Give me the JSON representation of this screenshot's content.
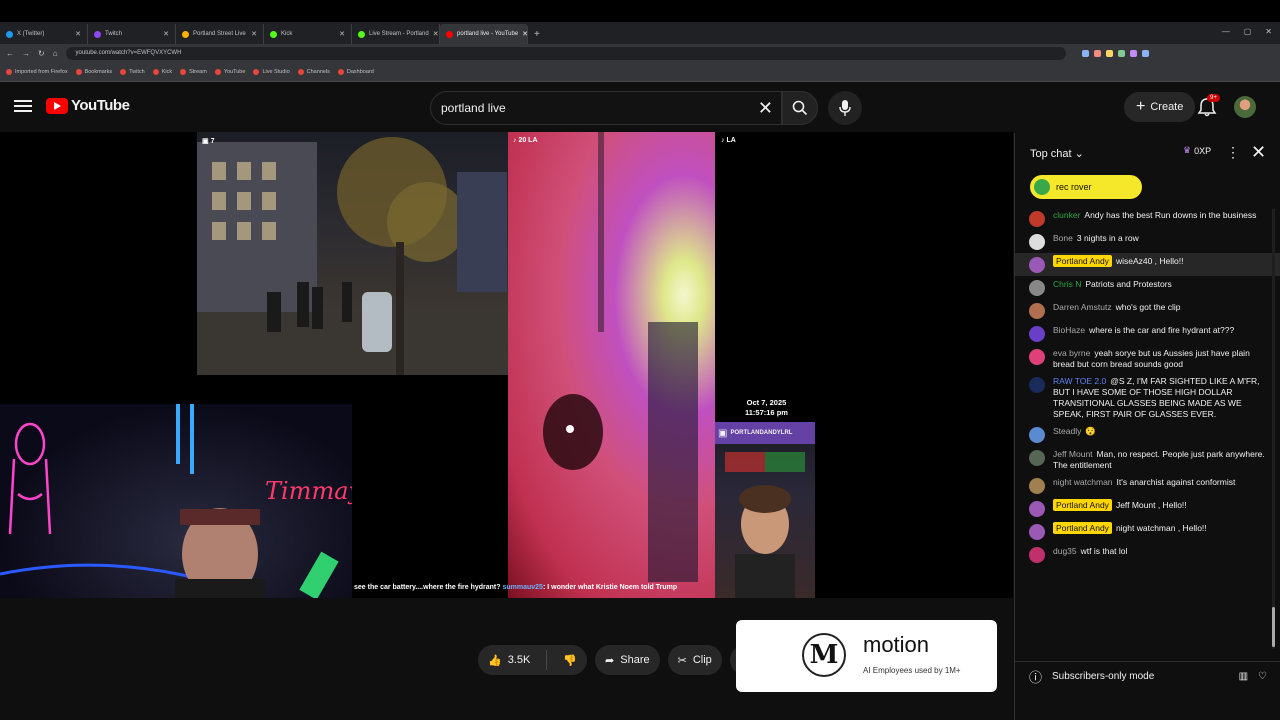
{
  "browser": {
    "tabs": [
      {
        "label": "X (Twitter)",
        "color": "#1d9bf0"
      },
      {
        "label": "Twitch",
        "color": "#9146ff"
      },
      {
        "label": "Portland Street Live",
        "color": "#ffb000"
      },
      {
        "label": "Kick",
        "color": "#53fc18"
      },
      {
        "label": "Live Stream - Portland",
        "color": "#53fc18"
      },
      {
        "label": "portland live - YouTube",
        "color": "#ff0000",
        "active": true
      }
    ],
    "url": "youtube.com/watch?v=EWFQVXYCWH",
    "bookmarks": [
      "Imported from Firefox",
      "Bookmarks",
      "Twitch",
      "Kick",
      "Stream",
      "YouTube",
      "Live Studio",
      "Channels",
      "Dashboard"
    ]
  },
  "masthead": {
    "logo_text": "YouTube",
    "search_value": "portland live",
    "create_label": "Create",
    "notification_badge": "9+"
  },
  "video": {
    "tag_left": "7",
    "tag_mid": "20 LA",
    "tag_right": "LA",
    "caption_pre": "see the car battery....where the fire hydrant?",
    "caption_user": "summauv25",
    "caption_post": ": I wonder what Kristie Noem told Trump",
    "date_line1": "Oct 7, 2025",
    "date_line2": "11:57:16 pm",
    "twitch_name": "PORTLANDANDYLRL",
    "webcam_neon": "Timmay"
  },
  "actions": {
    "likes": "3.5K",
    "share": "Share",
    "clip": "Clip"
  },
  "ad": {
    "title": "motion",
    "subtitle": "AI Employees used by 1M+"
  },
  "chat": {
    "header": "Top chat",
    "xp": "0XP",
    "pinned_user": "rec rover",
    "footer": "Subscribers-only mode",
    "messages": [
      {
        "author": "clunker",
        "text": "Andy has the best Run downs in the business",
        "kind": "member",
        "av": "#c0392b"
      },
      {
        "author": "Bone",
        "text": "3 nights in a row",
        "kind": "",
        "av": "#dddddd"
      },
      {
        "author": "Portland Andy",
        "text": "wiseAz40 , Hello!!",
        "kind": "owner",
        "av": "#9a59b5",
        "hl": true
      },
      {
        "author": "Chris N",
        "text": "Patriots and Protestors",
        "kind": "member",
        "av": "#888888"
      },
      {
        "author": "Darren Amstutz",
        "text": "who's got the clip",
        "kind": "",
        "av": "#b07050"
      },
      {
        "author": "BioHaze",
        "text": "where is the car and fire hydrant at???",
        "kind": "",
        "av": "#6a3fc7"
      },
      {
        "author": "eva byrne",
        "text": "yeah sorye but us Aussies just have plain bread but corn bread sounds good",
        "kind": "",
        "av": "#e0407a"
      },
      {
        "author": "RAW TOE 2.0",
        "text": "@S Z, I'M FAR SIGHTED LIKE A M'FR, BUT I HAVE SOME OF THOSE HIGH DOLLAR TRANSITIONAL GLASSES BEING MADE AS WE SPEAK, FIRST PAIR OF GLASSES EVER.",
        "kind": "mod",
        "av": "#1a2a5a"
      },
      {
        "author": "Steadly",
        "text": "😯",
        "kind": "",
        "av": "#5a8ad0"
      },
      {
        "author": "Jeff Mount",
        "text": "Man, no respect. People just park anywhere. The entitlement",
        "kind": "",
        "av": "#556655"
      },
      {
        "author": "night watchman",
        "text": "It's anarchist against conformist",
        "kind": "",
        "av": "#a08050"
      },
      {
        "author": "Portland Andy",
        "text": "Jeff Mount , Hello!!",
        "kind": "owner",
        "av": "#9a59b5"
      },
      {
        "author": "Portland Andy",
        "text": "night watchman , Hello!!",
        "kind": "owner",
        "av": "#9a59b5"
      },
      {
        "author": "dug35",
        "text": "wtf is that lol",
        "kind": "",
        "av": "#c0306a"
      }
    ]
  }
}
